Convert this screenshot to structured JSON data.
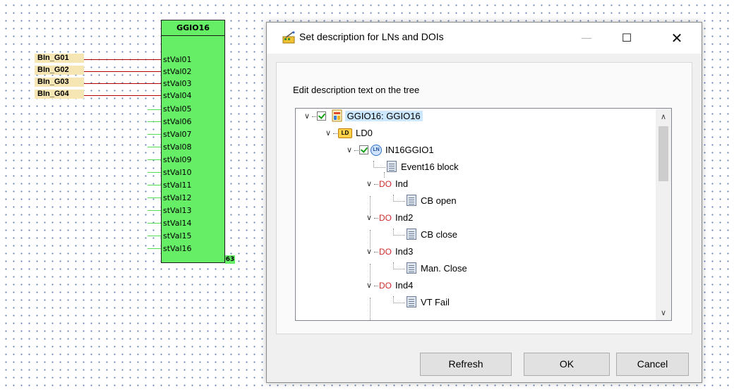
{
  "diagram": {
    "block_title": "GGIO16",
    "inputs": [
      "BIn_G01",
      "BIn_G02",
      "BIn_G03",
      "BIn_G04"
    ],
    "ports": [
      "stVal01",
      "stVal02",
      "stVal03",
      "stVal04",
      "stVal05",
      "stVal06",
      "stVal07",
      "stVal08",
      "stVal09",
      "stVal10",
      "stVal11",
      "stVal12",
      "stVal13",
      "stVal14",
      "stVal15",
      "stVal16"
    ],
    "block_number": "63"
  },
  "dialog": {
    "title": "Set description for LNs and DOIs",
    "controls": {
      "minimize": "—",
      "maximize": "☐",
      "close": "✕"
    },
    "instruction": "Edit description text on the tree",
    "tree": {
      "root": "GGIO16: GGIO16",
      "ld": "LD0",
      "ln": "IN16GGIO1",
      "ln_desc": "Event16 block",
      "dos": [
        {
          "tag": "DO",
          "name": "Ind",
          "desc": "CB open"
        },
        {
          "tag": "DO",
          "name": "Ind2",
          "desc": "CB close"
        },
        {
          "tag": "DO",
          "name": "Ind3",
          "desc": "Man. Close"
        },
        {
          "tag": "DO",
          "name": "Ind4",
          "desc": "VT Fail"
        }
      ],
      "ld_icon_text": "LD",
      "ln_icon_text": "LN"
    },
    "buttons": {
      "refresh": "Refresh",
      "ok": "OK",
      "cancel": "Cancel"
    }
  },
  "colors": {
    "block_fill": "#66ee66",
    "input_tag": "#f5e6b3",
    "wire_connected": "#b30000",
    "wire_free": "#55dd55",
    "selection": "#cce8ff",
    "do_tag": "#cc2b2b"
  }
}
